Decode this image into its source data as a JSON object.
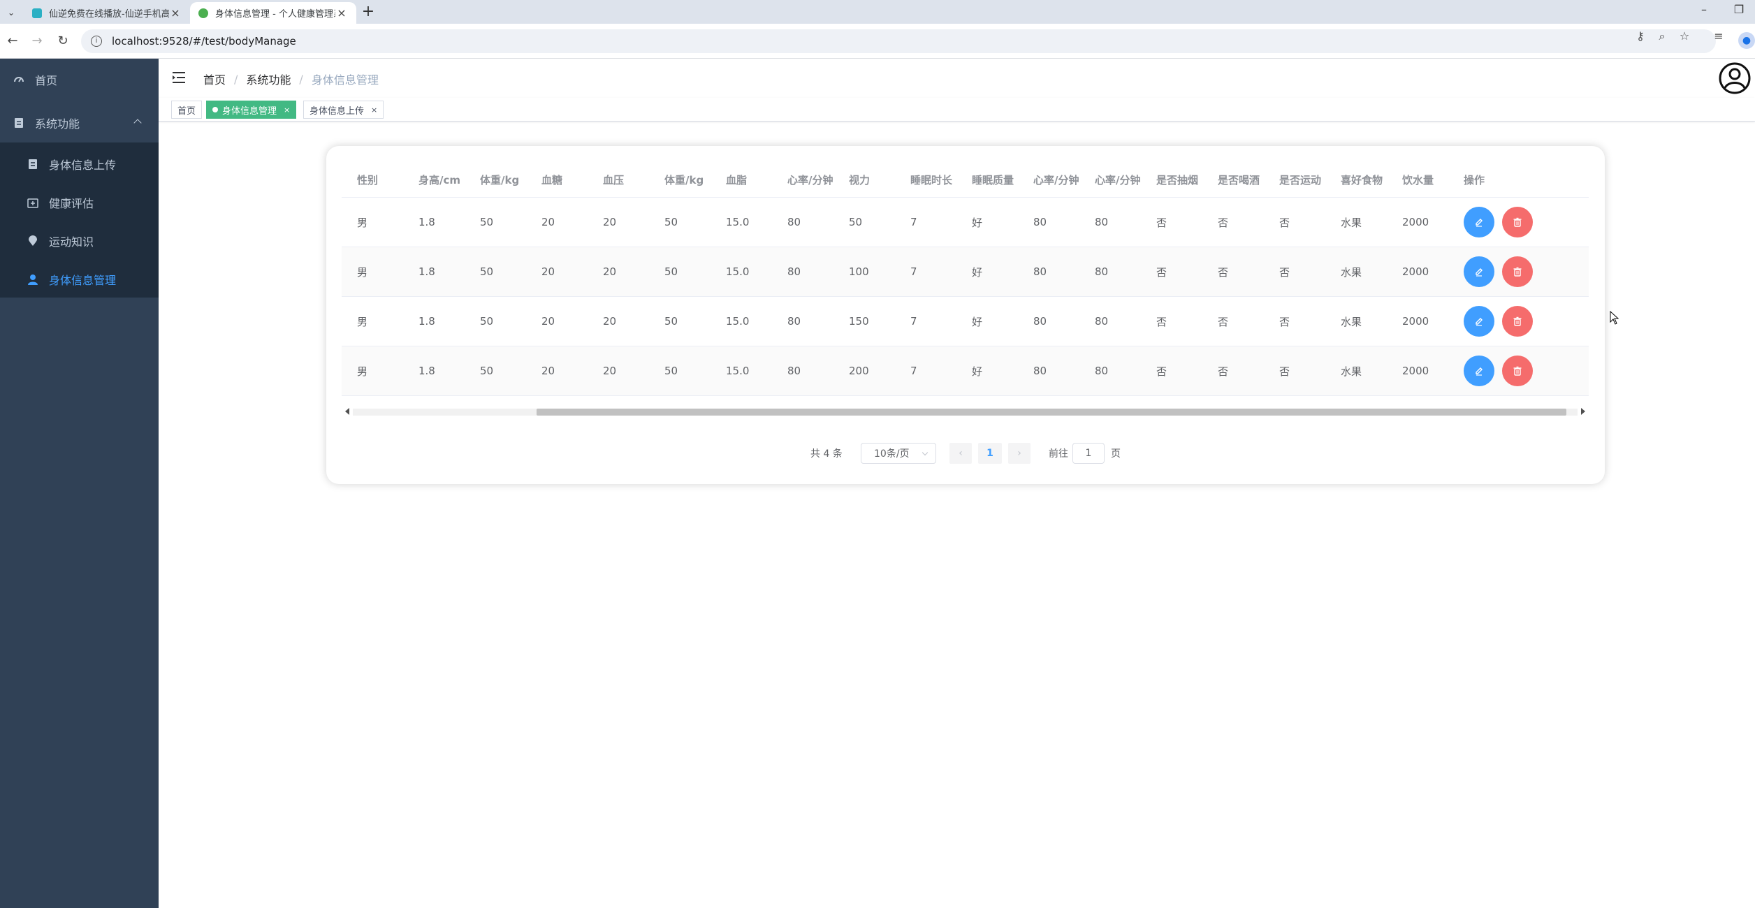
{
  "browser": {
    "tabs": [
      {
        "title": "仙逆免费在线播放-仙逆手机高清",
        "favicon_color": "#2bb0c4"
      },
      {
        "title": "身体信息管理 - 个人健康管理系统",
        "favicon_color": "#4caf50"
      }
    ],
    "url": "localhost:9528/#/test/bodyManage"
  },
  "sidebar": {
    "items": [
      {
        "label": "首页",
        "icon": "dashboard-icon"
      },
      {
        "label": "系统功能",
        "icon": "document-icon"
      },
      {
        "label": "身体信息上传",
        "icon": "document-icon"
      },
      {
        "label": "健康评估",
        "icon": "medical-kit-icon"
      },
      {
        "label": "运动知识",
        "icon": "location-icon"
      },
      {
        "label": "身体信息管理",
        "icon": "user-icon"
      }
    ],
    "active_index": 5,
    "colors": {
      "bg": "#304156",
      "submenu_bg": "#1f2d3d",
      "text": "#bfcbd9",
      "active": "#409eff"
    }
  },
  "breadcrumb": [
    "首页",
    "系统功能",
    "身体信息管理"
  ],
  "tags": [
    {
      "label": "首页"
    },
    {
      "label": "身体信息管理",
      "active": true
    },
    {
      "label": "身体信息上传"
    }
  ],
  "table": {
    "headers": [
      "性别",
      "身高/cm",
      "体重/kg",
      "血糖",
      "血压",
      "体重/kg",
      "血脂",
      "心率/分钟",
      "视力",
      "睡眠时长",
      "睡眠质量",
      "心率/分钟",
      "心率/分钟",
      "是否抽烟",
      "是否喝酒",
      "是否运动",
      "喜好食物",
      "饮水量",
      "操作"
    ],
    "rows": [
      [
        "男",
        "1.8",
        "50",
        "20",
        "20",
        "50",
        "15.0",
        "80",
        "50",
        "7",
        "好",
        "80",
        "80",
        "否",
        "否",
        "否",
        "水果",
        "2000"
      ],
      [
        "男",
        "1.8",
        "50",
        "20",
        "20",
        "50",
        "15.0",
        "80",
        "100",
        "7",
        "好",
        "80",
        "80",
        "否",
        "否",
        "否",
        "水果",
        "2000"
      ],
      [
        "男",
        "1.8",
        "50",
        "20",
        "20",
        "50",
        "15.0",
        "80",
        "150",
        "7",
        "好",
        "80",
        "80",
        "否",
        "否",
        "否",
        "水果",
        "2000"
      ],
      [
        "男",
        "1.8",
        "50",
        "20",
        "20",
        "50",
        "15.0",
        "80",
        "200",
        "7",
        "好",
        "80",
        "80",
        "否",
        "否",
        "否",
        "水果",
        "2000"
      ]
    ]
  },
  "pagination": {
    "total_text": "共 4 条",
    "page_size": "10条/页",
    "current_page": "1",
    "goto_prefix": "前往",
    "goto_value": "1",
    "goto_suffix": "页"
  }
}
